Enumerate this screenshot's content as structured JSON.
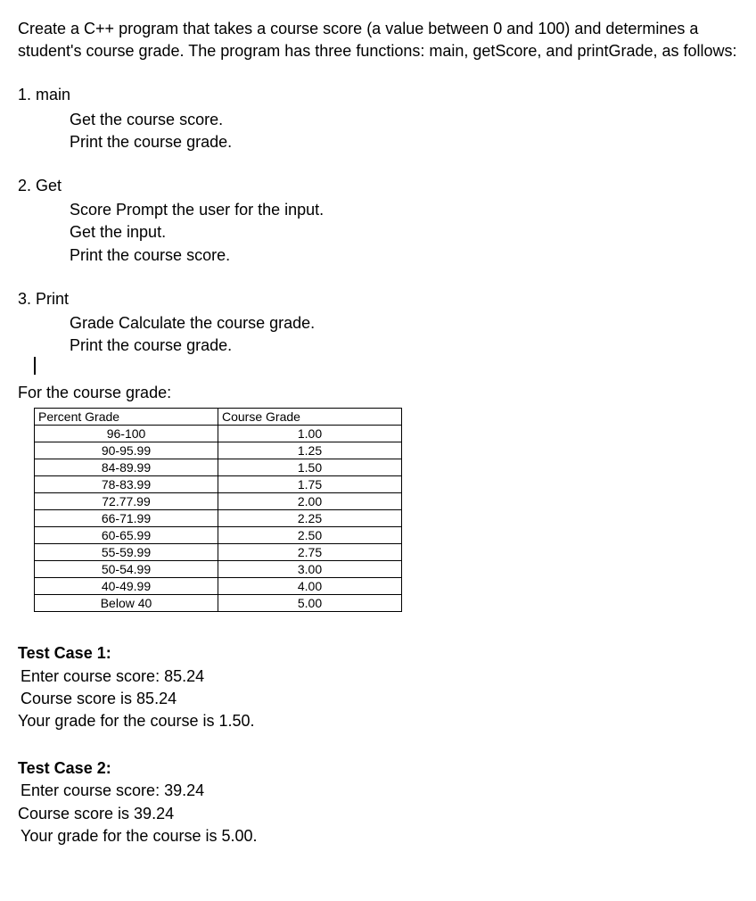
{
  "intro": "Create a C++ program that takes a course score (a value between 0 and 100) and determines a student's course grade. The program has three functions: main, getScore, and printGrade, as follows:",
  "items": [
    {
      "num": "1. main",
      "subs": [
        "Get the course score.",
        "Print the course grade."
      ]
    },
    {
      "num": "2. Get",
      "subs": [
        "Score Prompt the user for the input.",
        "Get the input.",
        "Print the course score."
      ]
    },
    {
      "num": "3. Print",
      "subs": [
        "Grade Calculate the course grade.",
        "Print the course grade."
      ]
    }
  ],
  "for_grade_label": "For the course grade:",
  "chart_data": {
    "type": "table",
    "headers": [
      "Percent Grade",
      "Course Grade"
    ],
    "rows": [
      [
        "96-100",
        "1.00"
      ],
      [
        "90-95.99",
        "1.25"
      ],
      [
        "84-89.99",
        "1.50"
      ],
      [
        "78-83.99",
        "1.75"
      ],
      [
        "72.77.99",
        "2.00"
      ],
      [
        "66-71.99",
        "2.25"
      ],
      [
        "60-65.99",
        "2.50"
      ],
      [
        "55-59.99",
        "2.75"
      ],
      [
        "50-54.99",
        "3.00"
      ],
      [
        "40-49.99",
        "4.00"
      ],
      [
        "Below 40",
        "5.00"
      ]
    ]
  },
  "test_cases": [
    {
      "title": "Test Case 1:",
      "lines": [
        "Enter course score: 85.24",
        "Course score is 85.24",
        "Your grade for the course is 1.50."
      ]
    },
    {
      "title": "Test Case 2:",
      "lines": [
        "Enter course score: 39.24",
        "Course score is 39.24",
        "Your grade for the course is 5.00."
      ]
    }
  ]
}
